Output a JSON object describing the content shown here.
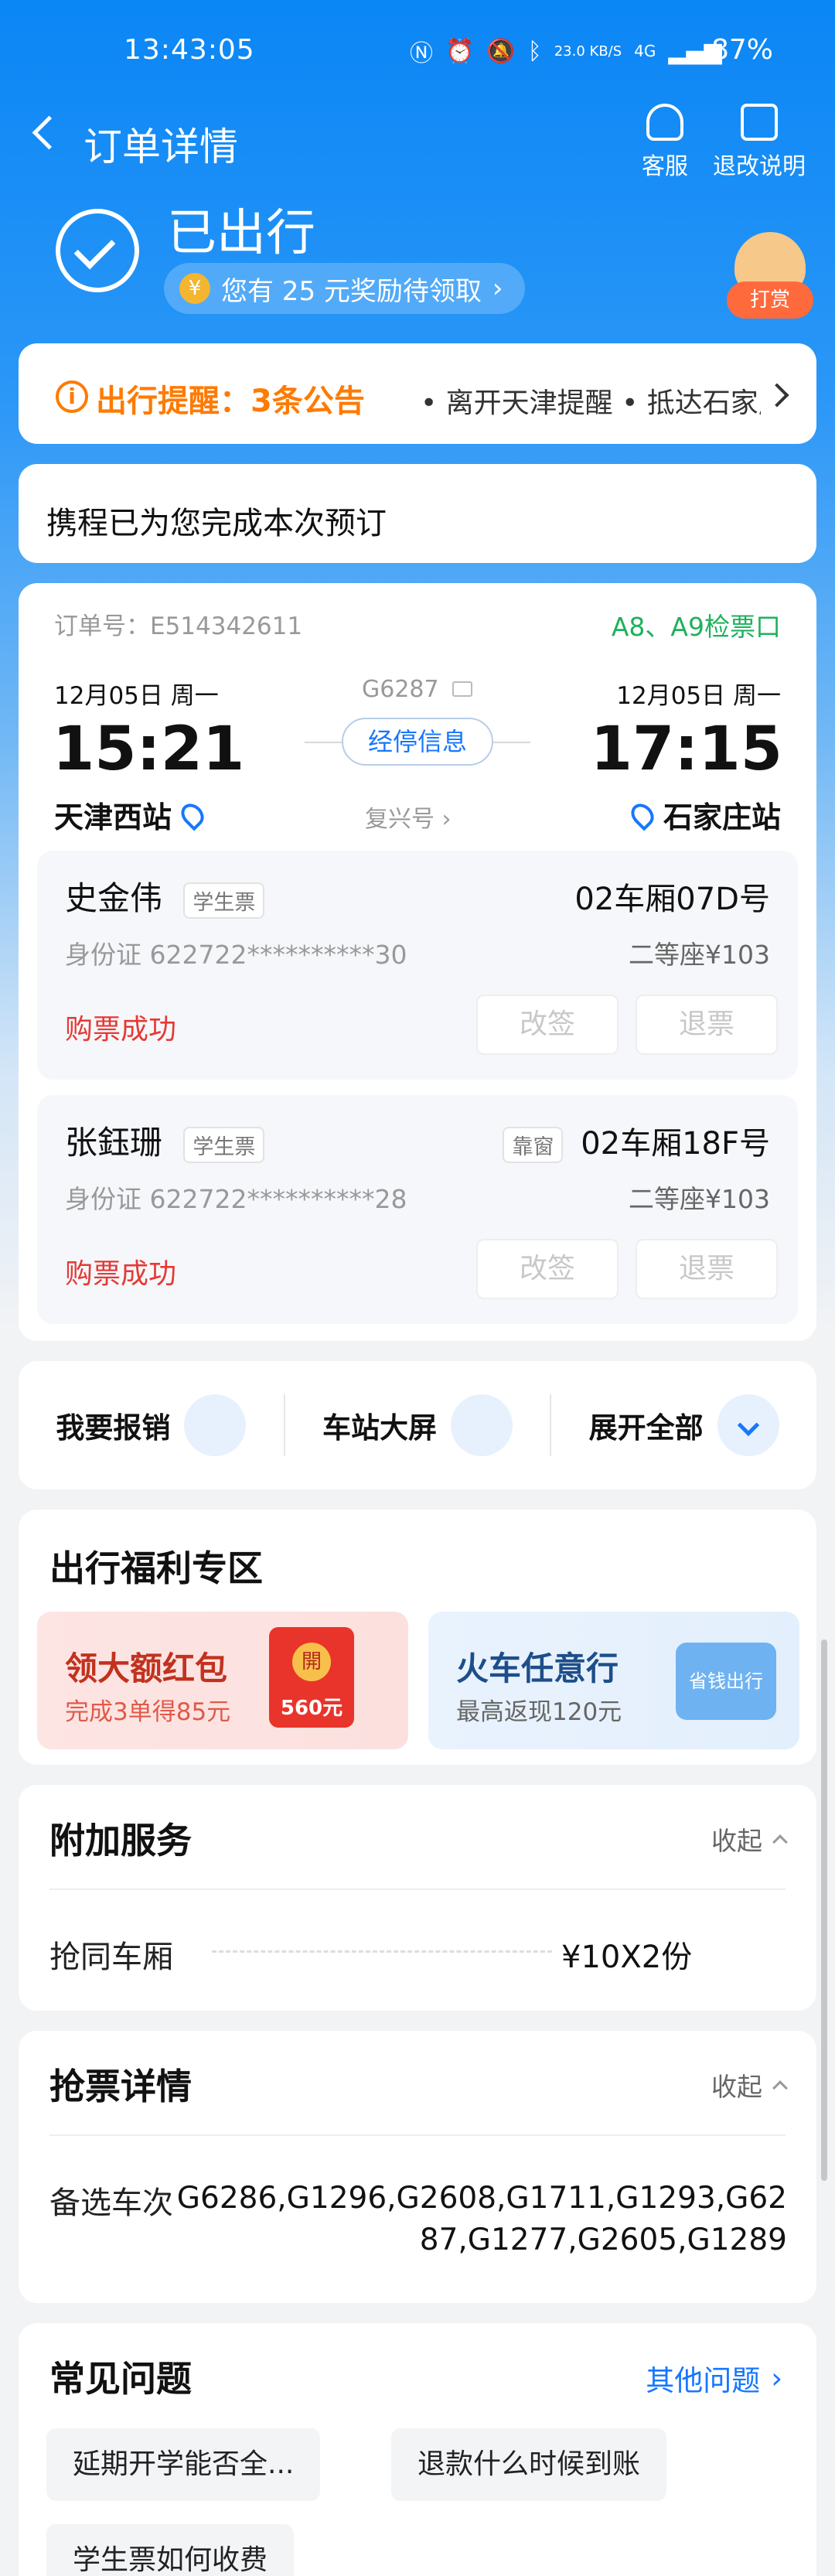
{
  "status_bar": {
    "time": "13:43:05",
    "speed": "23.0 KB/S",
    "network": "4G",
    "battery": "87%"
  },
  "nav": {
    "title": "订单详情",
    "customer_service": "客服",
    "refund_explain": "退改说明"
  },
  "order_status": {
    "title": "已出行",
    "reward_text": "您有 25 元奖励待领取",
    "reward_icon": "¥",
    "tip_label": "打赏"
  },
  "reminder": {
    "label": "出行提醒：3条公告",
    "items": "• 离开天津提醒  • 抵达石家庄提醒"
  },
  "booking_note": "携程已为您完成本次预订",
  "trip": {
    "order_no": "订单号：E514342611",
    "gate": "A8、A9检票口",
    "depart_date": "12月05日 周一",
    "depart_time": "15:21",
    "depart_station": "天津西站",
    "train_no": "G6287",
    "stops_label": "经停信息",
    "train_type": "复兴号",
    "arrive_date": "12月05日 周一",
    "arrive_time": "17:15",
    "arrive_station": "石家庄站"
  },
  "passengers": [
    {
      "name": "史金伟",
      "ticket_type": "学生票",
      "window_tag": "",
      "seat": "02车厢07D号",
      "id": "身份证 622722**********30",
      "class": "二等座¥103",
      "status": "购票成功",
      "change": "改签",
      "refund": "退票"
    },
    {
      "name": "张鈺珊",
      "ticket_type": "学生票",
      "window_tag": "靠窗",
      "seat": "02车厢18F号",
      "id": "身份证 622722**********28",
      "class": "二等座¥103",
      "status": "购票成功",
      "change": "改签",
      "refund": "退票"
    }
  ],
  "quick_actions": {
    "reimburse": "我要报销",
    "station_screen": "车站大屏",
    "expand": "展开全部"
  },
  "welfare": {
    "title": "出行福利专区",
    "promo1_title": "领大额红包",
    "promo1_sub": "完成3单得85元",
    "promo1_badge": "560元",
    "promo1_open": "開",
    "promo2_title": "火车任意行",
    "promo2_sub": "最高返现120元",
    "promo2_badge": "省钱出行"
  },
  "addon": {
    "title": "附加服务",
    "collapse": "收起",
    "item_label": "抢同车厢",
    "item_value": "¥10X2份"
  },
  "grab": {
    "title": "抢票详情",
    "collapse": "收起",
    "label": "备选车次",
    "line1": "G6286,G1296,G2608,G1711,G1293,G62",
    "line2": "87,G1277,G2605,G1289"
  },
  "faq": {
    "title": "常见问题",
    "more": "其他问题",
    "q1": "延期开学能否全...",
    "q2": "退款什么时候到账",
    "q3": "学生票如何收费"
  }
}
